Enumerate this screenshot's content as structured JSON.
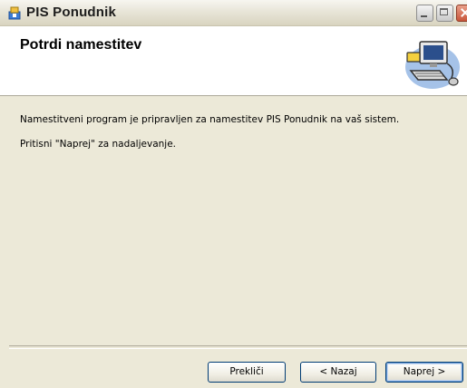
{
  "window": {
    "title": "PIS Ponudnik"
  },
  "banner": {
    "title": "Potrdi namestitev",
    "icon": "computer-install-icon"
  },
  "content": {
    "line1": "Namestitveni program je pripravljen za namestitev PIS Ponudnik na vaš sistem.",
    "line2": "Pritisni \"Naprej\" za nadaljevanje."
  },
  "buttons": {
    "cancel": "Prekliči",
    "back": "< Nazaj",
    "next": "Naprej >"
  },
  "icons": {
    "app": "installer-app-icon",
    "minimize": "minimize-icon",
    "maximize": "maximize-icon",
    "close": "close-icon"
  }
}
